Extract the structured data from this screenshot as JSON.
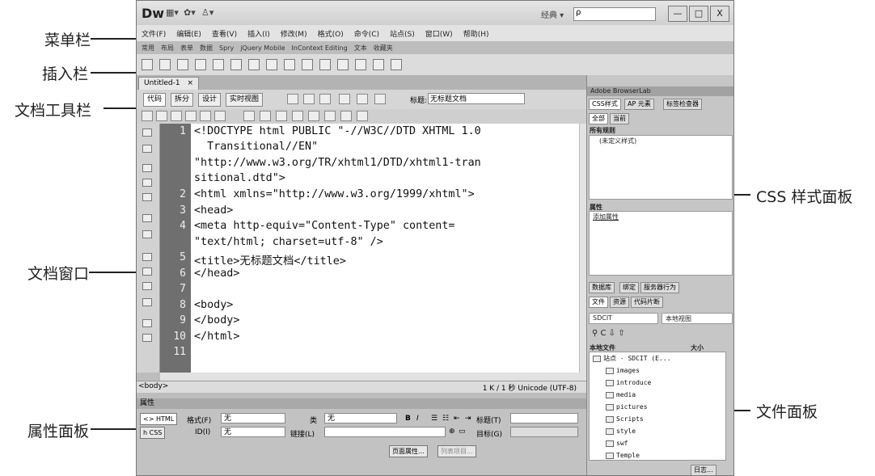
{
  "annotations": {
    "menubar": "菜单栏",
    "insertbar": "插入栏",
    "doctoolbar": "文档工具栏",
    "docwindow": "文档窗口",
    "properties": "属性面板",
    "css_panel": "CSS 样式面板",
    "files_panel": "文件面板"
  },
  "titlebar": {
    "logo": "Dw",
    "workspace": "经典 ▾",
    "search_placeholder": "ρ",
    "buttons": [
      "—",
      "□",
      "X"
    ]
  },
  "menus": [
    "文件(F)",
    "编辑(E)",
    "查看(V)",
    "插入(I)",
    "修改(M)",
    "格式(O)",
    "命令(C)",
    "站点(S)",
    "窗口(W)",
    "帮助(H)"
  ],
  "insert_tabs": [
    "常用",
    "布局",
    "表单",
    "数据",
    "Spry",
    "jQuery Mobile",
    "InContext Editing",
    "文本",
    "收藏夹"
  ],
  "document": {
    "tab_name": "Untitled-1",
    "tab_close": "×",
    "views": [
      "代码",
      "拆分",
      "设计",
      "实时视图"
    ],
    "title_label": "标题:",
    "title_value": "无标题文档",
    "code_lines": [
      {
        "num": "1",
        "text": "<!DOCTYPE html PUBLIC \"-//W3C//DTD XHTML 1.0"
      },
      {
        "num": "",
        "text": "  Transitional//EN\""
      },
      {
        "num": "",
        "text": "\"http://www.w3.org/TR/xhtml1/DTD/xhtml1-tran"
      },
      {
        "num": "",
        "text": "sitional.dtd\">"
      },
      {
        "num": "2",
        "text": "<html xmlns=\"http://www.w3.org/1999/xhtml\">"
      },
      {
        "num": "3",
        "text": "<head>"
      },
      {
        "num": "4",
        "text": "<meta http-equiv=\"Content-Type\" content="
      },
      {
        "num": "",
        "text": "\"text/html; charset=utf-8\" />"
      },
      {
        "num": "5",
        "text": "<title>无标题文档</title>"
      },
      {
        "num": "6",
        "text": "</head>"
      },
      {
        "num": "7",
        "text": ""
      },
      {
        "num": "8",
        "text": "<body>"
      },
      {
        "num": "9",
        "text": "</body>"
      },
      {
        "num": "10",
        "text": "</html>"
      },
      {
        "num": "11",
        "text": ""
      }
    ],
    "status_left": "<body>",
    "status_right": "1 K / 1 秒  Unicode (UTF-8)"
  },
  "properties": {
    "header": "属性",
    "html_btn": "<> HTML",
    "css_btn": "h CSS",
    "format_label": "格式(F)",
    "format_value": "无",
    "class_label": "类",
    "class_value": "无",
    "id_label": "ID(I)",
    "id_value": "无",
    "link_label": "链接(L)",
    "bold": "B",
    "italic": "I",
    "heading_label": "标题(T)",
    "target_label": "目标(G)",
    "page_props_btn": "页面属性...",
    "list_item_btn": "列表项目..."
  },
  "right_panel": {
    "browserlab": "Adobe BrowserLab",
    "css_tabs": [
      "CSS样式",
      "AP 元素",
      "标签检查器"
    ],
    "css_subtabs": [
      "全部",
      "当前"
    ],
    "all_rules": "所有规则",
    "undefined_style": "(未定义样式)",
    "props_label": "属性",
    "add_prop": "添加属性",
    "db_tabs": [
      "数据库",
      "绑定",
      "服务器行为"
    ],
    "file_tabs": [
      "文件",
      "资源",
      "代码片断"
    ],
    "site_select": "SDCIT",
    "view_select": "本地视图",
    "col_local": "本地文件",
    "col_size": "大小",
    "site_root": "站点 - SDCIT (E...",
    "folders": [
      "images",
      "introduce",
      "media",
      "pictures",
      "Scripts",
      "style",
      "swf",
      "Temple"
    ],
    "log_btn": "日志..."
  }
}
